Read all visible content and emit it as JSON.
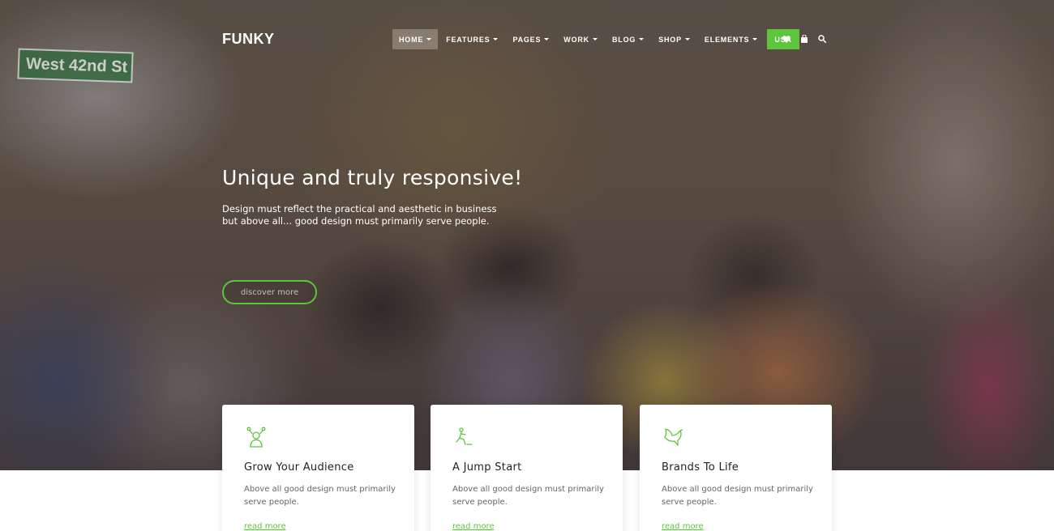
{
  "brand": {
    "logo": "FUNKY",
    "accent_color": "#5cc53b"
  },
  "hero": {
    "background_sign_text": "West 42nd St",
    "title": "Unique and truly responsive!",
    "subtitle": "Design must reflect the practical and aesthetic in business but above all... good design must primarily serve people.",
    "cta_label": "discover more"
  },
  "nav": {
    "items": [
      {
        "label": "HOME",
        "active": true,
        "dropdown": true
      },
      {
        "label": "FEATURES",
        "dropdown": true
      },
      {
        "label": "PAGES",
        "dropdown": true
      },
      {
        "label": "WORK",
        "dropdown": true
      },
      {
        "label": "BLOG",
        "dropdown": true
      },
      {
        "label": "SHOP",
        "dropdown": true
      },
      {
        "label": "ELEMENTS",
        "dropdown": true
      }
    ],
    "cta": "USA",
    "icons": [
      "heart-icon",
      "shopping-bag-icon",
      "search-icon"
    ]
  },
  "cards": [
    {
      "icon": "audience-icon",
      "title": "Grow Your Audience",
      "text": "Above all good design must primarily serve people.",
      "link": "read more"
    },
    {
      "icon": "jump-start-icon",
      "title": "A Jump Start",
      "text": "Above all good design must primarily serve people.",
      "link": "read more"
    },
    {
      "icon": "dove-icon",
      "title": "Brands To Life",
      "text": "Above all good design must primarily serve people.",
      "link": "read more"
    }
  ]
}
